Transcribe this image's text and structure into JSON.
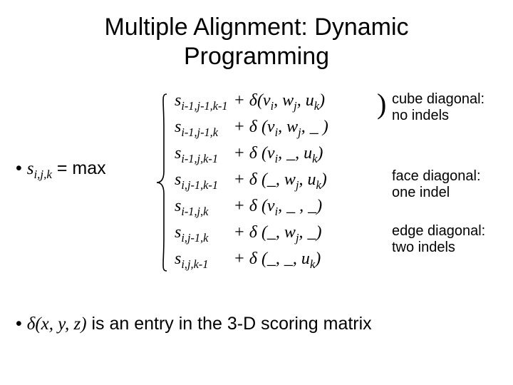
{
  "title_line1": "Multiple Alignment: Dynamic",
  "title_line2": "Programming",
  "lhs": {
    "s": "s",
    "sub": "i,j,k",
    "eqmax": " = max"
  },
  "cases": [
    {
      "s": "s",
      "ssub": "i-1,j-1,k-1",
      "plus": "+  ",
      "d": "δ(v",
      "dsub1": "i",
      "dmid": ", w",
      "dsub2": "j",
      "dend": ", u",
      "dsub3": "k",
      "dclose": ")"
    },
    {
      "s": "s",
      "ssub": "i-1,j-1,k",
      "plus": "+ ",
      "d": "δ (v",
      "dsub1": "i",
      "dmid": ", w",
      "dsub2": "j",
      "dend": ", _ )",
      "dsub3": "",
      "dclose": ""
    },
    {
      "s": "s",
      "ssub": "i-1,j,k-1",
      "plus": "+ ",
      "d": "δ (v",
      "dsub1": "i",
      "dmid": ", _, ",
      "dsub2": "",
      "dend": " u",
      "dsub3": "k",
      "dclose": ")"
    },
    {
      "s": "s",
      "ssub": "i,j-1,k-1",
      "plus": "+ ",
      "d": "δ (_, w",
      "dsub1": "",
      "dmid": "",
      "dsub2": "j",
      "dend": ", u",
      "dsub3": "k",
      "dclose": ")"
    },
    {
      "s": "s",
      "ssub": "i-1,j,k",
      "plus": "+ ",
      "d": "δ (v",
      "dsub1": "i",
      "dmid": ", _ , _)",
      "dsub2": "",
      "dend": "",
      "dsub3": "",
      "dclose": ""
    },
    {
      "s": "s",
      "ssub": "i,j-1,k",
      "plus": "+ ",
      "d": "δ (_, w",
      "dsub1": "",
      "dmid": "",
      "dsub2": "j",
      "dend": ", _)",
      "dsub3": "",
      "dclose": ""
    },
    {
      "s": "s",
      "ssub": "i,j,k-1",
      "plus": "+ ",
      "d": "δ (_, _, u",
      "dsub1": "",
      "dmid": "",
      "dsub2": "",
      "dend": "",
      "dsub3": "k",
      "dclose": ")"
    }
  ],
  "annotations": {
    "cube_l1": "cube diagonal:",
    "cube_l2": "no indels",
    "face_l1": "face diagonal:",
    "face_l2": "one indel",
    "edge_l1": "edge diagonal:",
    "edge_l2": "two indels"
  },
  "footer": {
    "pre": "δ(x, y, z)",
    "post": " is an entry in the 3-D scoring matrix"
  }
}
